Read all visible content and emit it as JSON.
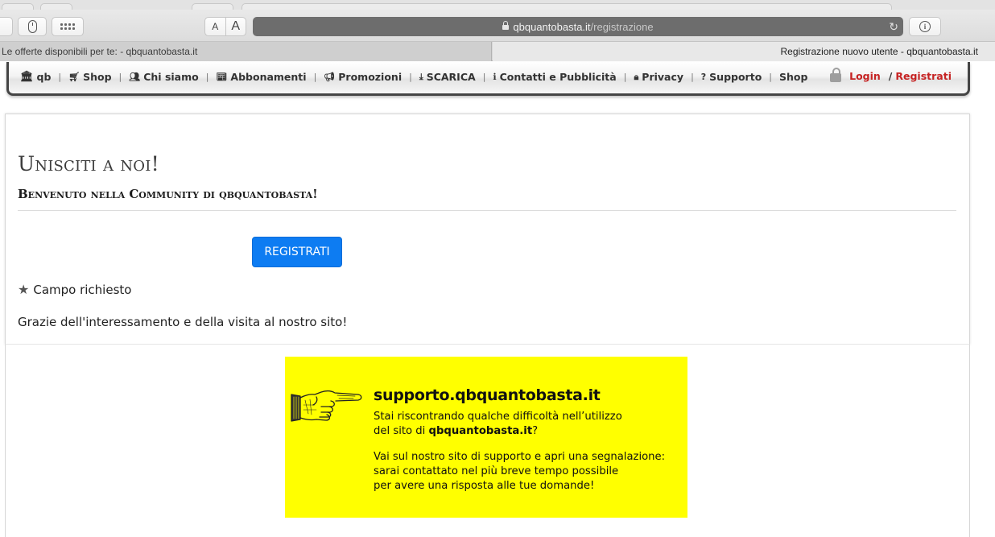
{
  "browser": {
    "url_domain": "qbquantobasta.it",
    "url_path": "/registrazione",
    "font_small": "A",
    "font_large": "A",
    "tabs": [
      {
        "title": "Le offerte disponibili per te: - qbquantobasta.it"
      },
      {
        "title": "Registrazione nuovo utente - qbquantobasta.it"
      }
    ]
  },
  "nav": {
    "items": [
      {
        "label": "qb",
        "icon": "bank-icon"
      },
      {
        "label": "Shop",
        "icon": "cart-icon"
      },
      {
        "label": "Chi siamo",
        "icon": "users-icon"
      },
      {
        "label": "Abbonamenti",
        "icon": "newspaper-icon"
      },
      {
        "label": "Promozioni",
        "icon": "bullhorn-icon"
      },
      {
        "label": "SCARICA",
        "icon": "download-icon"
      },
      {
        "label": "Contatti e Pubblicità",
        "icon": "info-icon"
      },
      {
        "label": "Privacy",
        "icon": "lock-icon"
      },
      {
        "label": "Supporto",
        "icon": "question-icon"
      },
      {
        "label": "Shop",
        "icon": ""
      }
    ],
    "login": "Login",
    "separator": "/",
    "register": "Registrati",
    "accent_color": "#c62323"
  },
  "main": {
    "title": "Unisciti a noi!",
    "subtitle": "Benvenuto nella Community di qbquantobasta!",
    "register_button": "REGISTRATI",
    "required_note": "Campo richiesto",
    "thanks": "Grazie dell'interessamento e della visita al nostro sito!",
    "button_color": "#0d7cf2"
  },
  "banner": {
    "title": "supporto.qbquantobasta.it",
    "line1": "Stai riscontrando qualche difficoltà nell’utilizzo",
    "line2_pre": "del sito di ",
    "line2_bold": "qbquantobasta.it",
    "line2_post": "?",
    "line3": "Vai sul nostro sito di supporto e apri una segnalazione:",
    "line4": "sarai contattato nel più breve tempo possibile",
    "line5": "per avere una risposta alle tue domande!",
    "background": "#ffff00"
  }
}
